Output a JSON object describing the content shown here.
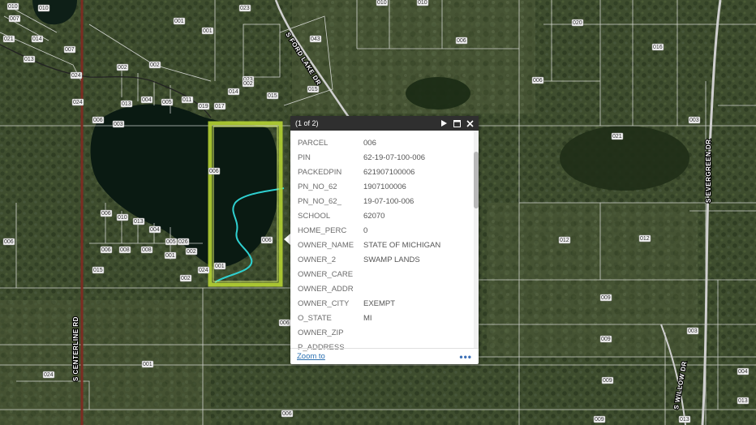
{
  "popup": {
    "counter": "(1 of 2)",
    "fields": [
      {
        "key": "PARCEL",
        "value": "006"
      },
      {
        "key": "PIN",
        "value": "62-19-07-100-006"
      },
      {
        "key": "PACKEDPIN",
        "value": "621907100006"
      },
      {
        "key": "PN_NO_62",
        "value": "1907100006"
      },
      {
        "key": "PN_NO_62_",
        "value": "19-07-100-006"
      },
      {
        "key": "SCHOOL",
        "value": "62070"
      },
      {
        "key": "HOME_PERC",
        "value": "0"
      },
      {
        "key": "OWNER_NAME",
        "value": "STATE OF MICHIGAN"
      },
      {
        "key": "OWNER_2",
        "value": "SWAMP LANDS"
      },
      {
        "key": "OWNER_CARE",
        "value": ""
      },
      {
        "key": "OWNER_ADDR",
        "value": ""
      },
      {
        "key": "OWNER_CITY",
        "value": "EXEMPT"
      },
      {
        "key": "O_STATE",
        "value": "MI"
      },
      {
        "key": "OWNER_ZIP",
        "value": ""
      },
      {
        "key": "P_ADDRESS",
        "value": ""
      }
    ],
    "zoom_label": "Zoom to",
    "more_label": "•••",
    "icons": {
      "next": "play-icon",
      "maximize": "maximize-icon",
      "close": "close-icon"
    }
  },
  "map": {
    "roads": [
      "S CENTERLINE RD",
      "S FORD LAKE DR",
      "S EVERGREEN DR",
      "S WILLOW DR"
    ],
    "parcel_labels": [
      "022",
      "023",
      "043",
      "001",
      "006",
      "010",
      "020",
      "016",
      "021",
      "003",
      "012",
      "009",
      "013",
      "004",
      "024",
      "002",
      "007",
      "008",
      "014",
      "015",
      "005",
      "011",
      "017",
      "018",
      "019",
      "026"
    ],
    "colors": {
      "selected_outline": "#b5d333",
      "water": "#0a1a12",
      "stream": "#2fd0d0",
      "parcel_lines": "#e8e8e8",
      "road": "#8b3a2a"
    }
  }
}
